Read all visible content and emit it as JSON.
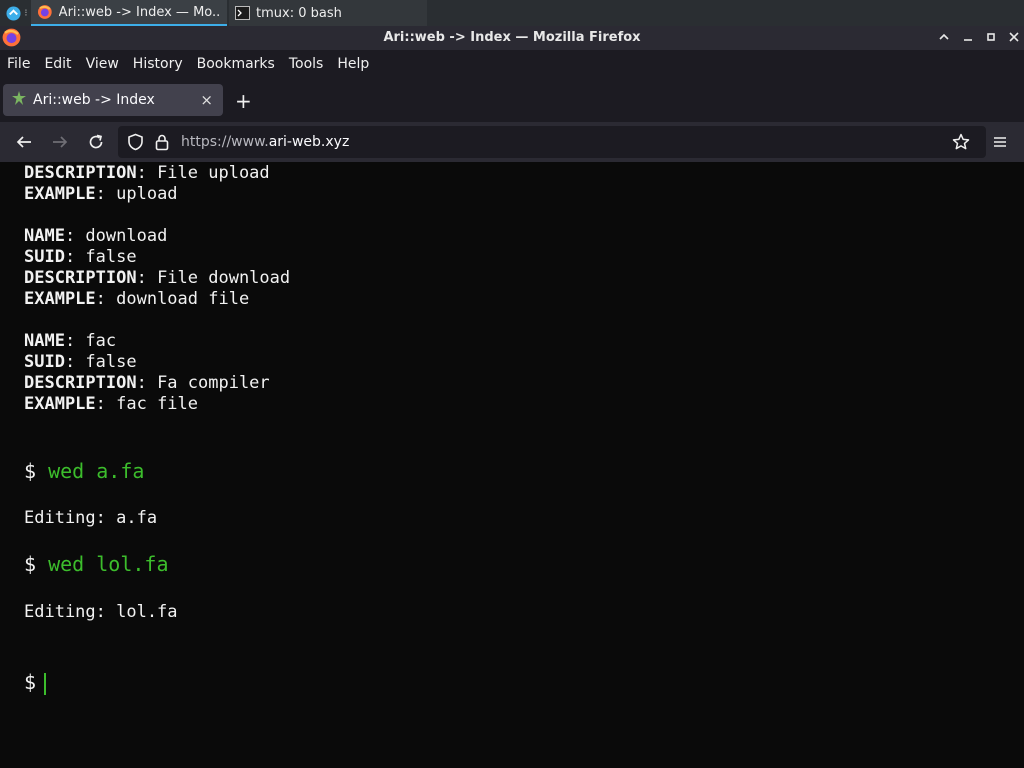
{
  "taskbar": {
    "tasks": [
      {
        "label": "Ari::web -> Index — Mo..."
      },
      {
        "label": "tmux: 0 bash"
      }
    ]
  },
  "window": {
    "title": "Ari::web -> Index — Mozilla Firefox"
  },
  "menu": [
    "File",
    "Edit",
    "View",
    "History",
    "Bookmarks",
    "Tools",
    "Help"
  ],
  "tab": {
    "label": "Ari::web -> Index",
    "close": "×",
    "new_tab": "+"
  },
  "url": {
    "prefix": "https://www.",
    "host": "ari-web.xyz"
  },
  "terminal": {
    "entries": [
      {
        "key": "DESCRIPTION",
        "value": ": File upload"
      },
      {
        "key": "EXAMPLE",
        "value": ": upload"
      },
      {
        "key": "NAME",
        "value": ": download"
      },
      {
        "key": "SUID",
        "value": ": false"
      },
      {
        "key": "DESCRIPTION",
        "value": ": File download"
      },
      {
        "key": "EXAMPLE",
        "value": ": download file"
      },
      {
        "key": "NAME",
        "value": ": fac"
      },
      {
        "key": "SUID",
        "value": ": false"
      },
      {
        "key": "DESCRIPTION",
        "value": ": Fa compiler"
      },
      {
        "key": "EXAMPLE",
        "value": ": fac file"
      }
    ],
    "prompt_symbol": "$",
    "commands": [
      {
        "command": "wed a.fa",
        "output": "Editing: a.fa"
      },
      {
        "command": "wed lol.fa",
        "output": "Editing: lol.fa"
      }
    ]
  },
  "colors": {
    "command_green": "#3cbd2c",
    "background": "#0a0a0a",
    "text": "#f2f2f2"
  }
}
